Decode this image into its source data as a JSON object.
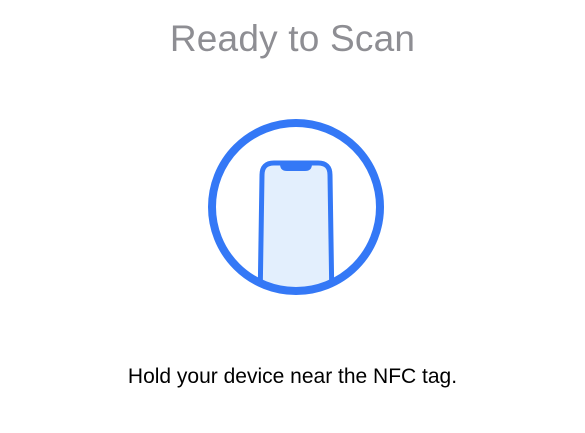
{
  "dialog": {
    "title": "Ready to Scan",
    "instruction": "Hold your device near the NFC tag.",
    "icon": "phone-in-circle-icon"
  },
  "colors": {
    "accent": "#3478f6",
    "phone_fill": "#e3effd",
    "title_text": "#8e8e93",
    "body_text": "#000000",
    "background": "#ffffff"
  }
}
